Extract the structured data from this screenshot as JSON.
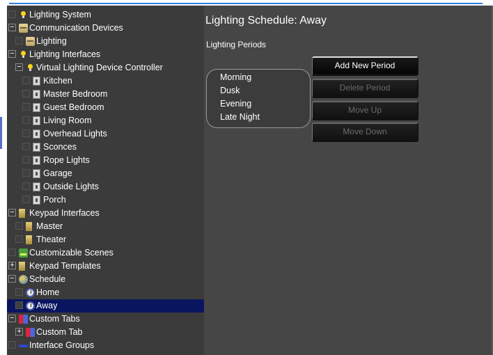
{
  "tree": {
    "items": [
      {
        "level": 0,
        "toggle": "none",
        "checkbox": true,
        "icon": "bulb-icon",
        "label": "Lighting System"
      },
      {
        "level": 0,
        "toggle": "minus",
        "checkbox": false,
        "icon": "comm-device-icon",
        "label": "Communication Devices"
      },
      {
        "level": 1,
        "toggle": "none",
        "checkbox": true,
        "icon": "comm-device-icon",
        "label": "Lighting"
      },
      {
        "level": 0,
        "toggle": "minus",
        "checkbox": false,
        "icon": "bulb-icon",
        "label": "Lighting Interfaces"
      },
      {
        "level": 1,
        "toggle": "minus",
        "checkbox": false,
        "icon": "bulb-icon",
        "label": "Virtual Lighting Device Controller"
      },
      {
        "level": 2,
        "toggle": "none",
        "checkbox": true,
        "icon": "light-device-icon",
        "label": "Kitchen"
      },
      {
        "level": 2,
        "toggle": "none",
        "checkbox": true,
        "icon": "light-device-icon",
        "label": "Master Bedroom"
      },
      {
        "level": 2,
        "toggle": "none",
        "checkbox": true,
        "icon": "light-device-icon",
        "label": "Guest Bedroom"
      },
      {
        "level": 2,
        "toggle": "none",
        "checkbox": true,
        "icon": "light-device-icon",
        "label": "Living Room"
      },
      {
        "level": 2,
        "toggle": "none",
        "checkbox": true,
        "icon": "light-device-icon",
        "label": "Overhead Lights"
      },
      {
        "level": 2,
        "toggle": "none",
        "checkbox": true,
        "icon": "light-device-icon",
        "label": "Sconces"
      },
      {
        "level": 2,
        "toggle": "none",
        "checkbox": true,
        "icon": "light-device-icon",
        "label": "Rope Lights"
      },
      {
        "level": 2,
        "toggle": "none",
        "checkbox": true,
        "icon": "light-device-icon",
        "label": "Garage"
      },
      {
        "level": 2,
        "toggle": "none",
        "checkbox": true,
        "icon": "light-device-icon",
        "label": "Outside Lights"
      },
      {
        "level": 2,
        "toggle": "none",
        "checkbox": true,
        "icon": "light-device-icon",
        "label": "Porch"
      },
      {
        "level": 0,
        "toggle": "minus",
        "checkbox": false,
        "icon": "keypad-icon",
        "label": "Keypad Interfaces"
      },
      {
        "level": 1,
        "toggle": "none",
        "checkbox": true,
        "icon": "keypad-icon",
        "label": "Master"
      },
      {
        "level": 1,
        "toggle": "none",
        "checkbox": true,
        "icon": "keypad-icon",
        "label": "Theater"
      },
      {
        "level": 0,
        "toggle": "none",
        "checkbox": true,
        "icon": "scenes-icon",
        "label": "Customizable Scenes"
      },
      {
        "level": 0,
        "toggle": "plus",
        "checkbox": false,
        "icon": "keypad-icon",
        "label": "Keypad Templates"
      },
      {
        "level": 0,
        "toggle": "minus",
        "checkbox": false,
        "icon": "schedule-globe-icon",
        "label": "Schedule"
      },
      {
        "level": 1,
        "toggle": "none",
        "checkbox": true,
        "icon": "clock-icon",
        "label": "Home"
      },
      {
        "level": 1,
        "toggle": "none",
        "checkbox": true,
        "icon": "clock-icon",
        "label": "Away",
        "selected": true
      },
      {
        "level": 0,
        "toggle": "minus",
        "checkbox": false,
        "icon": "custom-tabs-icon",
        "label": "Custom Tabs"
      },
      {
        "level": 1,
        "toggle": "plus",
        "checkbox": false,
        "icon": "custom-tabs-icon",
        "label": "Custom Tab"
      },
      {
        "level": 0,
        "toggle": "none",
        "checkbox": true,
        "icon": "interface-groups-icon",
        "label": "Interface Groups"
      }
    ]
  },
  "main": {
    "title": "Lighting Schedule: Away",
    "periods_label": "Lighting Periods",
    "periods": [
      "Morning",
      "Dusk",
      "Evening",
      "Late Night"
    ],
    "buttons": [
      {
        "label": "Add New Period",
        "enabled": true
      },
      {
        "label": "Delete Period",
        "enabled": false
      },
      {
        "label": "Move Up",
        "enabled": false
      },
      {
        "label": "Move Down",
        "enabled": false
      }
    ]
  },
  "colors": {
    "tree_background": "#3b3b3b",
    "panel_background": "#464646",
    "selection": "#0a1560",
    "accent_line": "#2f7de0"
  }
}
